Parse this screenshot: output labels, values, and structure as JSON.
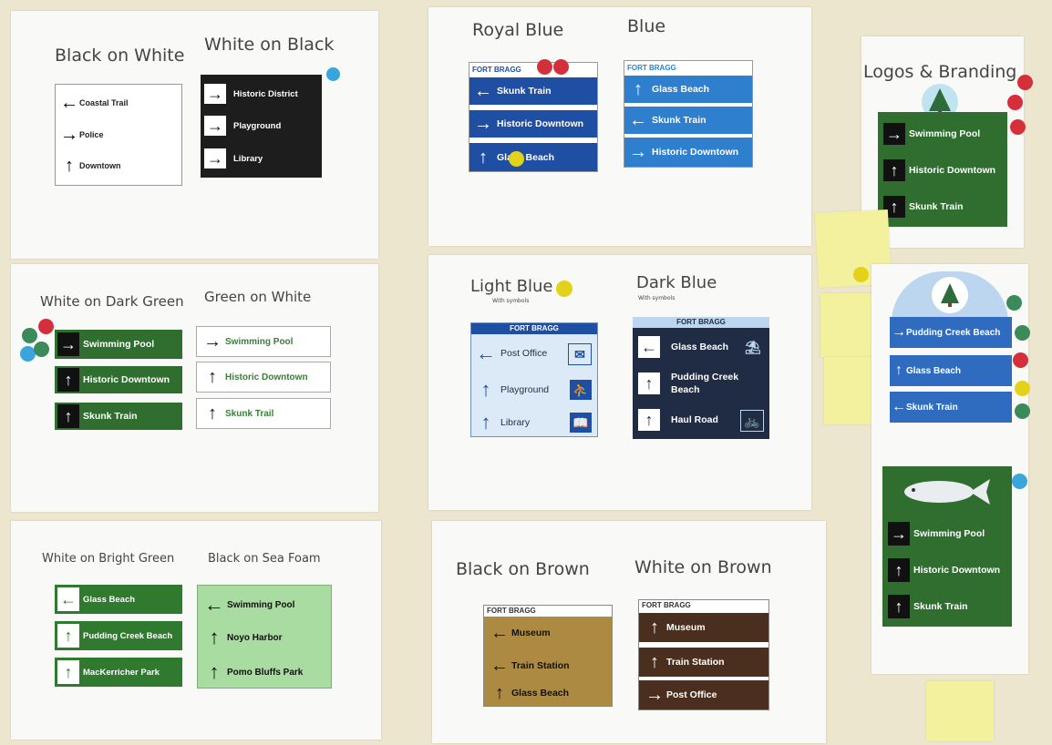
{
  "panels": {
    "bw": {
      "title_a": "Black on White",
      "title_b": "White on Black"
    },
    "blue": {
      "title_a": "Royal Blue",
      "title_b": "Blue"
    },
    "logos": {
      "title": "Logos & Branding"
    },
    "green": {
      "title_a": "White on Dark Green",
      "title_b": "Green on White"
    },
    "lightblue": {
      "title_a": "Light Blue",
      "sub_a": "With symbols",
      "title_b": "Dark Blue",
      "sub_b": "With symbols"
    },
    "bright": {
      "title_a": "White on Bright Green",
      "title_b": "Black on Sea Foam"
    },
    "brown": {
      "title_a": "Black on Brown",
      "title_b": "White on Brown"
    }
  },
  "brand": "FORT BRAGG",
  "signs": {
    "black_on_white": [
      "Coastal Trail",
      "Police",
      "Downtown"
    ],
    "white_on_black": [
      "Historic District",
      "Playground",
      "Library"
    ],
    "royal_blue": [
      "Skunk Train",
      "Historic Downtown",
      "Glass Beach"
    ],
    "blue": [
      "Glass Beach",
      "Skunk Train",
      "Historic Downtown"
    ],
    "logo_green": [
      "Swimming Pool",
      "Historic Downtown",
      "Skunk Train"
    ],
    "logo_blue": [
      "Pudding Creek Beach",
      "Glass Beach",
      "Skunk Train"
    ],
    "logo_fish": [
      "Swimming Pool",
      "Historic Downtown",
      "Skunk Train"
    ],
    "dark_green": [
      "Swimming Pool",
      "Historic Downtown",
      "Skunk Train"
    ],
    "green_on_white": [
      "Swimming Pool",
      "Historic Downtown",
      "Skunk Trail"
    ],
    "light_blue": [
      "Post Office",
      "Playground",
      "Library"
    ],
    "dark_blue": [
      "Glass Beach",
      "Pudding Creek Beach",
      "Haul Road"
    ],
    "bright_green": [
      "Glass Beach",
      "Pudding Creek Beach",
      "MacKerricher Park"
    ],
    "sea_foam": [
      "Swimming Pool",
      "Noyo Harbor",
      "Pomo Bluffs Park"
    ],
    "black_on_brown": [
      "Museum",
      "Train Station",
      "Glass Beach"
    ],
    "white_on_brown": [
      "Museum",
      "Train Station",
      "Post Office"
    ]
  },
  "icons": {
    "left": "←",
    "right": "→",
    "up": "↑",
    "post": "✉",
    "play": "⛹",
    "lib": "📖",
    "beach": "⛱",
    "bike": "🚲"
  },
  "colors": {
    "royal_blue": "#1f4fa3",
    "blue": "#2f7fcf",
    "dark_green": "#2f6e2f",
    "bright_green": "#2f7a2f",
    "sea_foam": "#a9dca0",
    "dark_blue": "#1f2c44",
    "light_blue": "#dceaf7",
    "brown": "#ad8a42",
    "dark_brown": "#4a2e1e"
  }
}
